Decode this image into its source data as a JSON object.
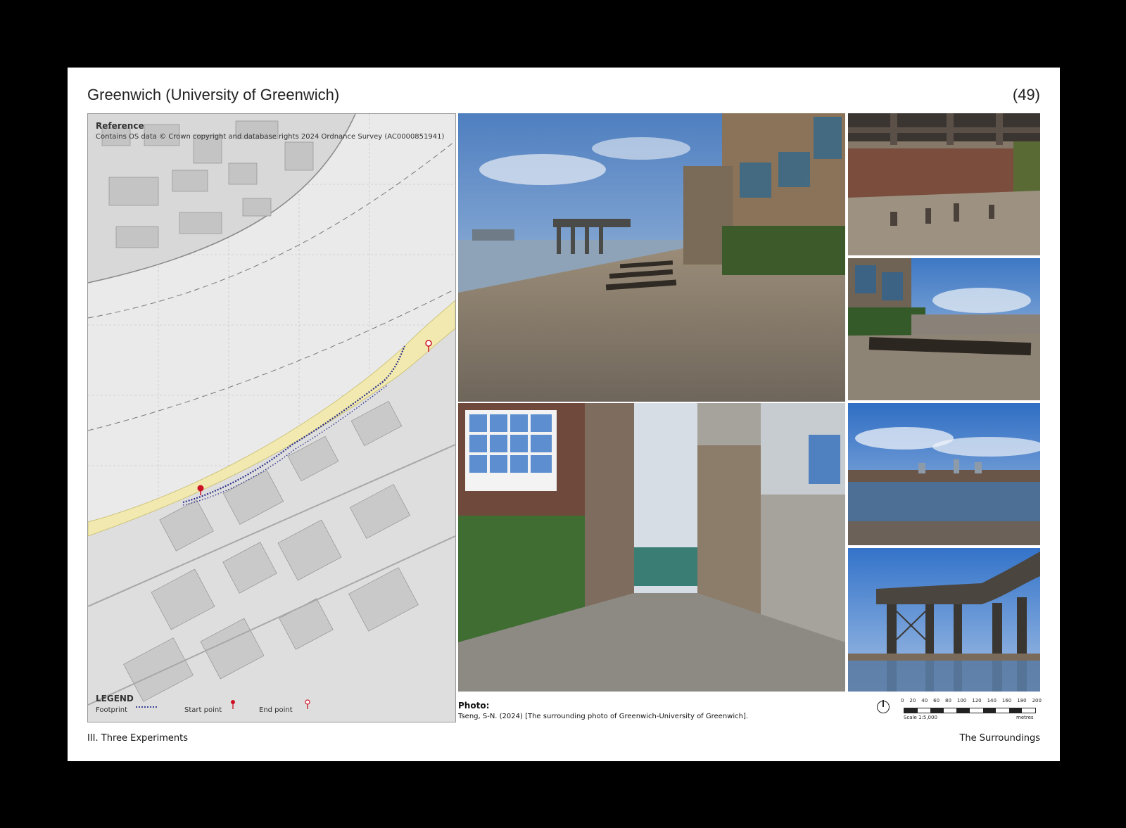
{
  "header": {
    "title": "Greenwich (University of Greenwich)",
    "page_number": "(49)"
  },
  "map": {
    "reference_title": "Reference",
    "reference_text": "Contains OS data © Crown copyright and database rights 2024 Ordnance Survey (AC0000851941)",
    "legend_title": "LEGEND",
    "legend_footprint": "Footprint",
    "legend_start": "Start point",
    "legend_end": "End point",
    "colors": {
      "river_path": "#f1e9b0",
      "footprint": "#2a2e8a",
      "start": "#cc1122",
      "end": "#cc1122"
    }
  },
  "photos": {
    "caption_title": "Photo:",
    "caption_text": "Tseng, S-N. (2024) [The surrounding photo of Greenwich-University of Greenwich]."
  },
  "scale": {
    "ticks": [
      "0",
      "20",
      "40",
      "60",
      "80",
      "100",
      "120",
      "140",
      "160",
      "180",
      "200"
    ],
    "ratio": "Scale 1:5,000",
    "unit": "metres"
  },
  "footer": {
    "left": "III. Three Experiments",
    "right": "The Surroundings"
  }
}
